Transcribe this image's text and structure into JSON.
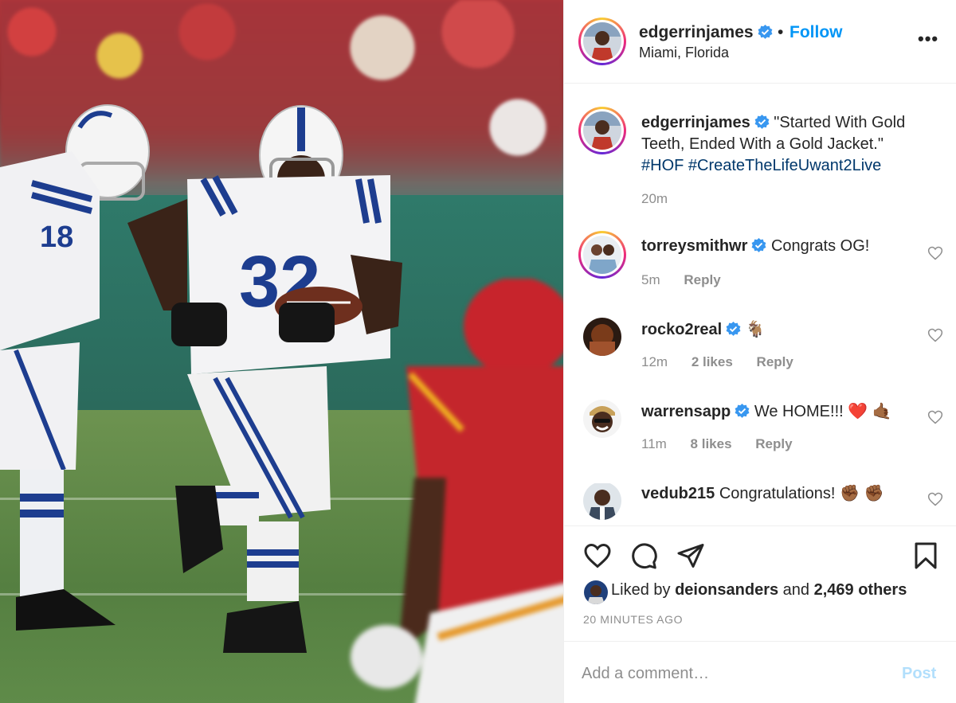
{
  "post": {
    "username": "edgerrinjames",
    "follow_label": "Follow",
    "dot": "•",
    "location": "Miami, Florida",
    "more_label": "•••",
    "caption_text": "\"Started With Gold Teeth, Ended With a Gold Jacket.\"",
    "hashtag_1": "#HOF",
    "hashtag_2": "#CreateTheLifeUwant2Live",
    "caption_time": "20m"
  },
  "comments": [
    {
      "username": "torreysmithwr",
      "verified": true,
      "text": "Congrats OG!",
      "time": "5m",
      "likes": "",
      "reply": "Reply"
    },
    {
      "username": "rocko2real",
      "verified": true,
      "text": "🐐",
      "time": "12m",
      "likes": "2 likes",
      "reply": "Reply"
    },
    {
      "username": "warrensapp",
      "verified": true,
      "text": "We HOME!!! ❤️ 🤙🏾",
      "time": "11m",
      "likes": "8 likes",
      "reply": "Reply"
    },
    {
      "username": "vedub215",
      "verified": false,
      "text": "Congratulations! ✊🏾 ✊🏾",
      "time": "",
      "likes": "",
      "reply": ""
    }
  ],
  "likes": {
    "prefix": "Liked by",
    "user": "deionsanders",
    "joiner": "and",
    "others": "2,469 others"
  },
  "timestamp": "20 MINUTES AGO",
  "comment_box": {
    "placeholder": "Add a comment…",
    "post_label": "Post"
  },
  "colors": {
    "link_blue": "#0095f6",
    "hashtag_blue": "#00376b",
    "muted": "#8e8e8e",
    "post_disabled": "#b2dffc",
    "verified_blue": "#3897f0"
  },
  "icons": [
    "heart-icon",
    "comment-icon",
    "share-icon",
    "bookmark-icon",
    "more-icon",
    "verified-badge-icon"
  ]
}
